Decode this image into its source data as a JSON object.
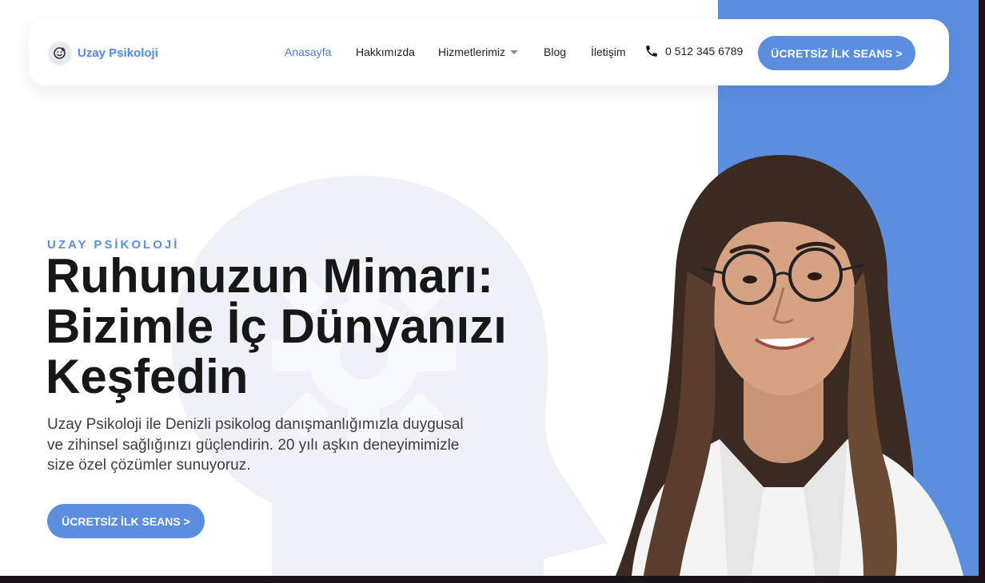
{
  "brand": {
    "name": "Uzay Psikoloji",
    "icon": "smile-icon",
    "color": "#5a8fe0"
  },
  "nav": {
    "items": [
      {
        "label": "Anasayfa",
        "active": true
      },
      {
        "label": "Hakkımızda",
        "active": false
      },
      {
        "label": "Hizmetlerimiz",
        "active": false,
        "dropdown": true
      },
      {
        "label": "Blog",
        "active": false
      },
      {
        "label": "İletişim",
        "active": false
      }
    ],
    "phone": {
      "icon": "phone-icon",
      "number": "0 512 345 6789"
    },
    "cta_label": "ÜCRETSİZ İLK SEANS >"
  },
  "hero": {
    "eyebrow": "UZAY PSİKOLOJİ",
    "title_line1": "Ruhunuzun Mimarı:",
    "title_line2": "Bizimle İç Dünyanızı",
    "title_line3": "Keşfedin",
    "description": "Uzay Psikoloji ile Denizli psikolog danışmanlığımızla duygusal ve zihinsel sağlığınızı güçlendirin. 20 yılı aşkın deneyimimizle size özel çözümler sunuyoruz.",
    "cta_label": "ÜCRETSİZ İLK SEANS >"
  },
  "colors": {
    "accent": "#5a8fe0",
    "active_link": "#4a7fcf",
    "heading": "#171717"
  }
}
